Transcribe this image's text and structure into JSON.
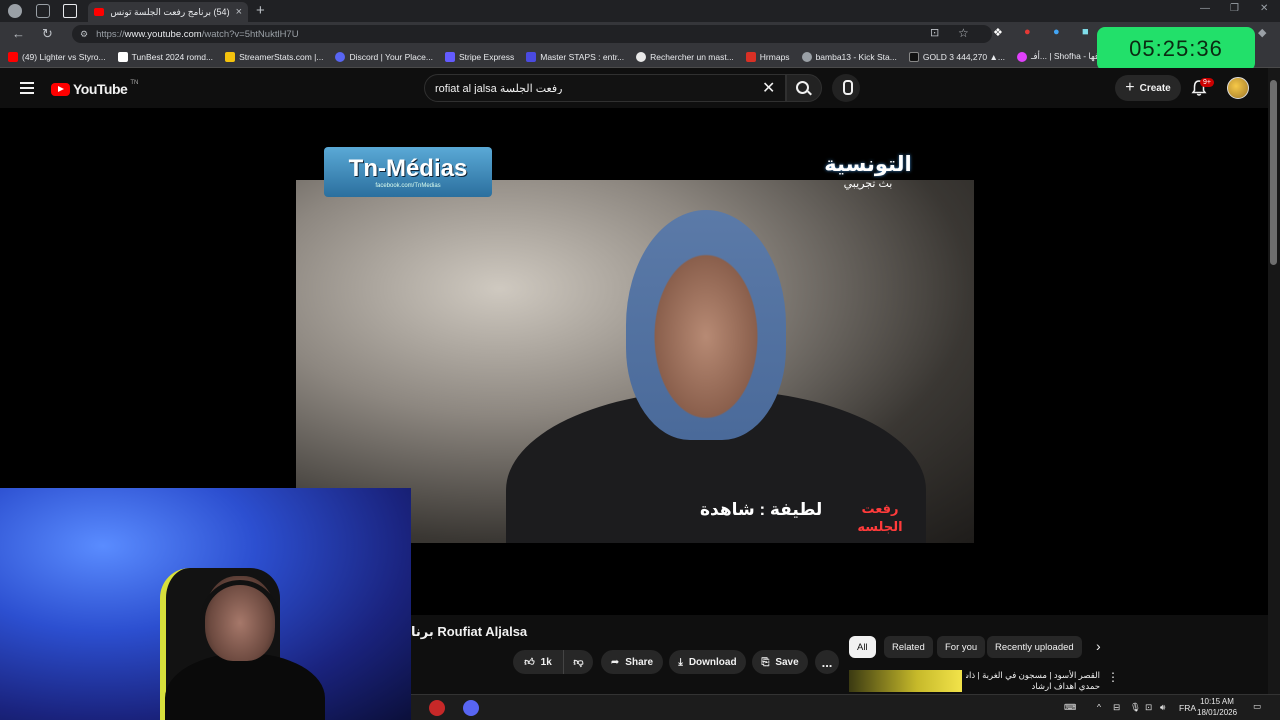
{
  "browser": {
    "tab_title": "(54) برنامج رفعت الجلسة تونس قد...",
    "tab_close": "×",
    "new_tab": "+",
    "url_host": "www.youtube.com",
    "url_prefix": "https://",
    "url_path": "/watch?v=5htNuktlH7U",
    "bookmarks": [
      {
        "label": "(49) Lighter vs Styro...",
        "color": "#ff0000"
      },
      {
        "label": "TunBest 2024 romd...",
        "color": "#ffffff"
      },
      {
        "label": "StreamerStats.com |...",
        "color": "#f4c20d"
      },
      {
        "label": "Discord | Your Place...",
        "color": "#5865f2"
      },
      {
        "label": "Stripe Express",
        "color": "#635bff"
      },
      {
        "label": "Master STAPS : entr...",
        "color": "#4a4ae0"
      },
      {
        "label": "Rechercher un mast...",
        "color": "#e8e8e8"
      },
      {
        "label": "Hrmaps",
        "color": "#d93025"
      },
      {
        "label": "bamba13 - Kick Sta...",
        "color": "#9aa0a6"
      },
      {
        "label": "GOLD 3 444,270 ▲...",
        "color": "#111111"
      },
      {
        "label": "أفـ... | Shofha - شوفها",
        "color": "#e040fb"
      }
    ],
    "timer": "05:25:36"
  },
  "header": {
    "logo": "YouTube",
    "logo_country": "TN",
    "search_value": "rofiat al jalsa رفعت الجلسة",
    "create_label": "Create",
    "notif_badge": "9+"
  },
  "video": {
    "watermark_left": "Tn-Médias",
    "watermark_left_sub": "facebook.com/TnMedias",
    "channel_logo": "التونسية",
    "channel_sub": "بث تجريبي",
    "lower_third": "لطيفة : شاهدة",
    "show_logo_1": "رفعت",
    "show_logo_2": "الجلسه",
    "title": "برنا Roufiat Aljalsa"
  },
  "actions": {
    "like_count": "1k",
    "share": "Share",
    "download": "Download",
    "save": "Save",
    "more": "..."
  },
  "chips": [
    "All",
    "Related",
    "For you",
    "Recently uploaded"
  ],
  "recommendation": {
    "title": "القصر الأسود | مسجون في الغربة | ذاشوقل",
    "title_line2": "حمدي اهداف ارشاد"
  },
  "taskbar": {
    "lang": "FRA",
    "time": "10:15 AM",
    "date": "18/01/2026"
  }
}
